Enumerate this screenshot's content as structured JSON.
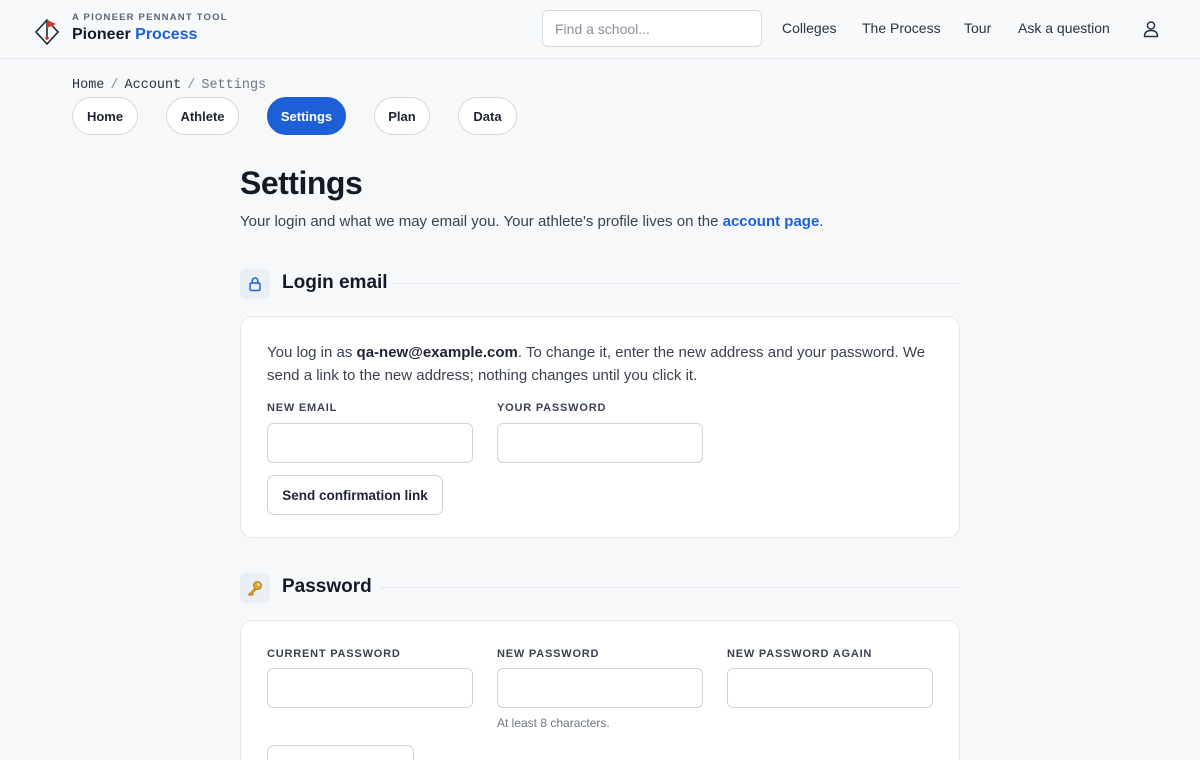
{
  "brand": {
    "kicker": "A PIONEER PENNANT TOOL",
    "name_part1": "Pioneer",
    "name_part2": "Process",
    "logo_icon": "pennant-diamond-icon"
  },
  "header": {
    "search_placeholder": "Find a school...",
    "nav": [
      "Colleges",
      "The Process",
      "Tour",
      "Ask a question"
    ],
    "user_icon": "user-icon"
  },
  "breadcrumb": {
    "items": [
      "Home",
      "Account"
    ],
    "separator": "/",
    "current": "Settings"
  },
  "tabs": [
    {
      "label": "Home"
    },
    {
      "label": "Athlete"
    },
    {
      "label": "Settings",
      "active": true
    },
    {
      "label": "Plan"
    },
    {
      "label": "Data"
    }
  ],
  "page": {
    "title": "Settings",
    "intro_before": "Your login and what we may email you. Your athlete's profile lives on the ",
    "intro_link": "account page",
    "intro_after": "."
  },
  "login_section": {
    "icon": "lock-icon",
    "title": "Login email",
    "text_before": "You log in as ",
    "email": "qa-new@example.com",
    "text_after": ". To change it, enter the new address and your password. We send a link to the new address; nothing changes until you click it.",
    "new_email_label": "NEW EMAIL",
    "new_email_value": "",
    "password_label": "YOUR PASSWORD",
    "password_value": "",
    "button": "Send confirmation link"
  },
  "password_section": {
    "icon": "key-icon",
    "title": "Password",
    "current_label": "CURRENT PASSWORD",
    "new_label": "NEW PASSWORD",
    "new_hint": "At least 8 characters.",
    "again_label": "NEW PASSWORD AGAIN"
  },
  "colors": {
    "accent": "#1d5fd6",
    "background": "#f7f8fa",
    "card": "#ffffff",
    "logo_red": "#d6322b"
  }
}
